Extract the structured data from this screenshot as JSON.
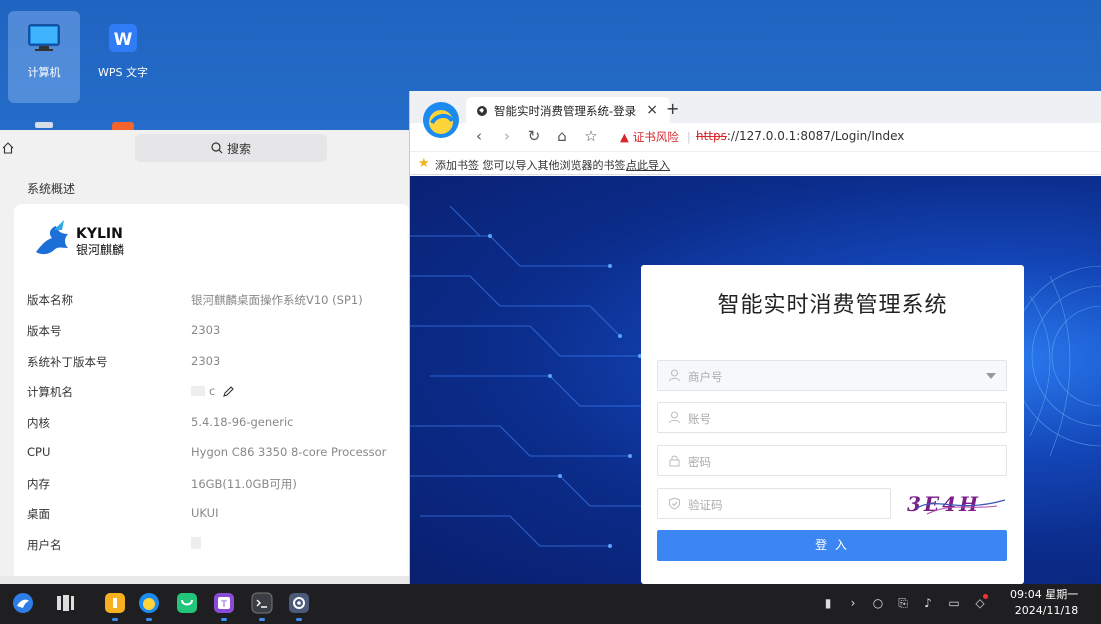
{
  "desktop": {
    "icons": [
      {
        "label": "计算机",
        "icon": "computer-icon"
      },
      {
        "label": "WPS 文字",
        "icon": "wps-writer-icon"
      },
      {
        "label": "",
        "icon": "trash-icon"
      },
      {
        "label": "",
        "icon": "document-icon"
      }
    ]
  },
  "settings": {
    "search_label": "搜索",
    "section_title": "系统概述",
    "logo": {
      "brand": "KYLIN",
      "cn": "银河麒麟"
    },
    "rows": [
      {
        "key": "版本名称",
        "value": "银河麒麟桌面操作系统V10 (SP1)"
      },
      {
        "key": "版本号",
        "value": "2303"
      },
      {
        "key": "系统补丁版本号",
        "value": "2303"
      },
      {
        "key": "计算机名",
        "value": "c"
      },
      {
        "key": "内核",
        "value": "5.4.18-96-generic"
      },
      {
        "key": "CPU",
        "value": "Hygon C86 3350  8-core Processor"
      },
      {
        "key": "内存",
        "value": "16GB(11.0GB可用)"
      },
      {
        "key": "桌面",
        "value": "UKUI"
      },
      {
        "key": "用户名",
        "value": ""
      }
    ]
  },
  "browser": {
    "tab_title": "智能实时消费管理系统-登录",
    "close_glyph": "×",
    "new_tab_glyph": "+",
    "cert_warning": "证书风险",
    "url_proto": "https",
    "url_rest": "://127.0.0.1:8087/Login/Index",
    "bookmark_text": "添加书签  您可以导入其他浏览器的书签,",
    "bookmark_link": "点此导入"
  },
  "login": {
    "title": "智能实时消费管理系统",
    "merchant_placeholder": "商户号",
    "account_placeholder": "账号",
    "password_placeholder": "密码",
    "captcha_placeholder": "验证码",
    "captcha_image_text": "3E4H",
    "submit_label": "登 入"
  },
  "taskbar": {
    "apps": [
      "kylin-start-icon",
      "multitask-icon",
      "file-manager-icon",
      "browser-icon",
      "software-store-icon",
      "text-editor-icon",
      "terminal-icon",
      "settings-icon"
    ],
    "time": "09:04 星期一",
    "date": "2024/11/18"
  },
  "colors": {
    "accent": "#3b86f2",
    "warning": "#d9262c",
    "taskbar": "#1f1f22"
  }
}
